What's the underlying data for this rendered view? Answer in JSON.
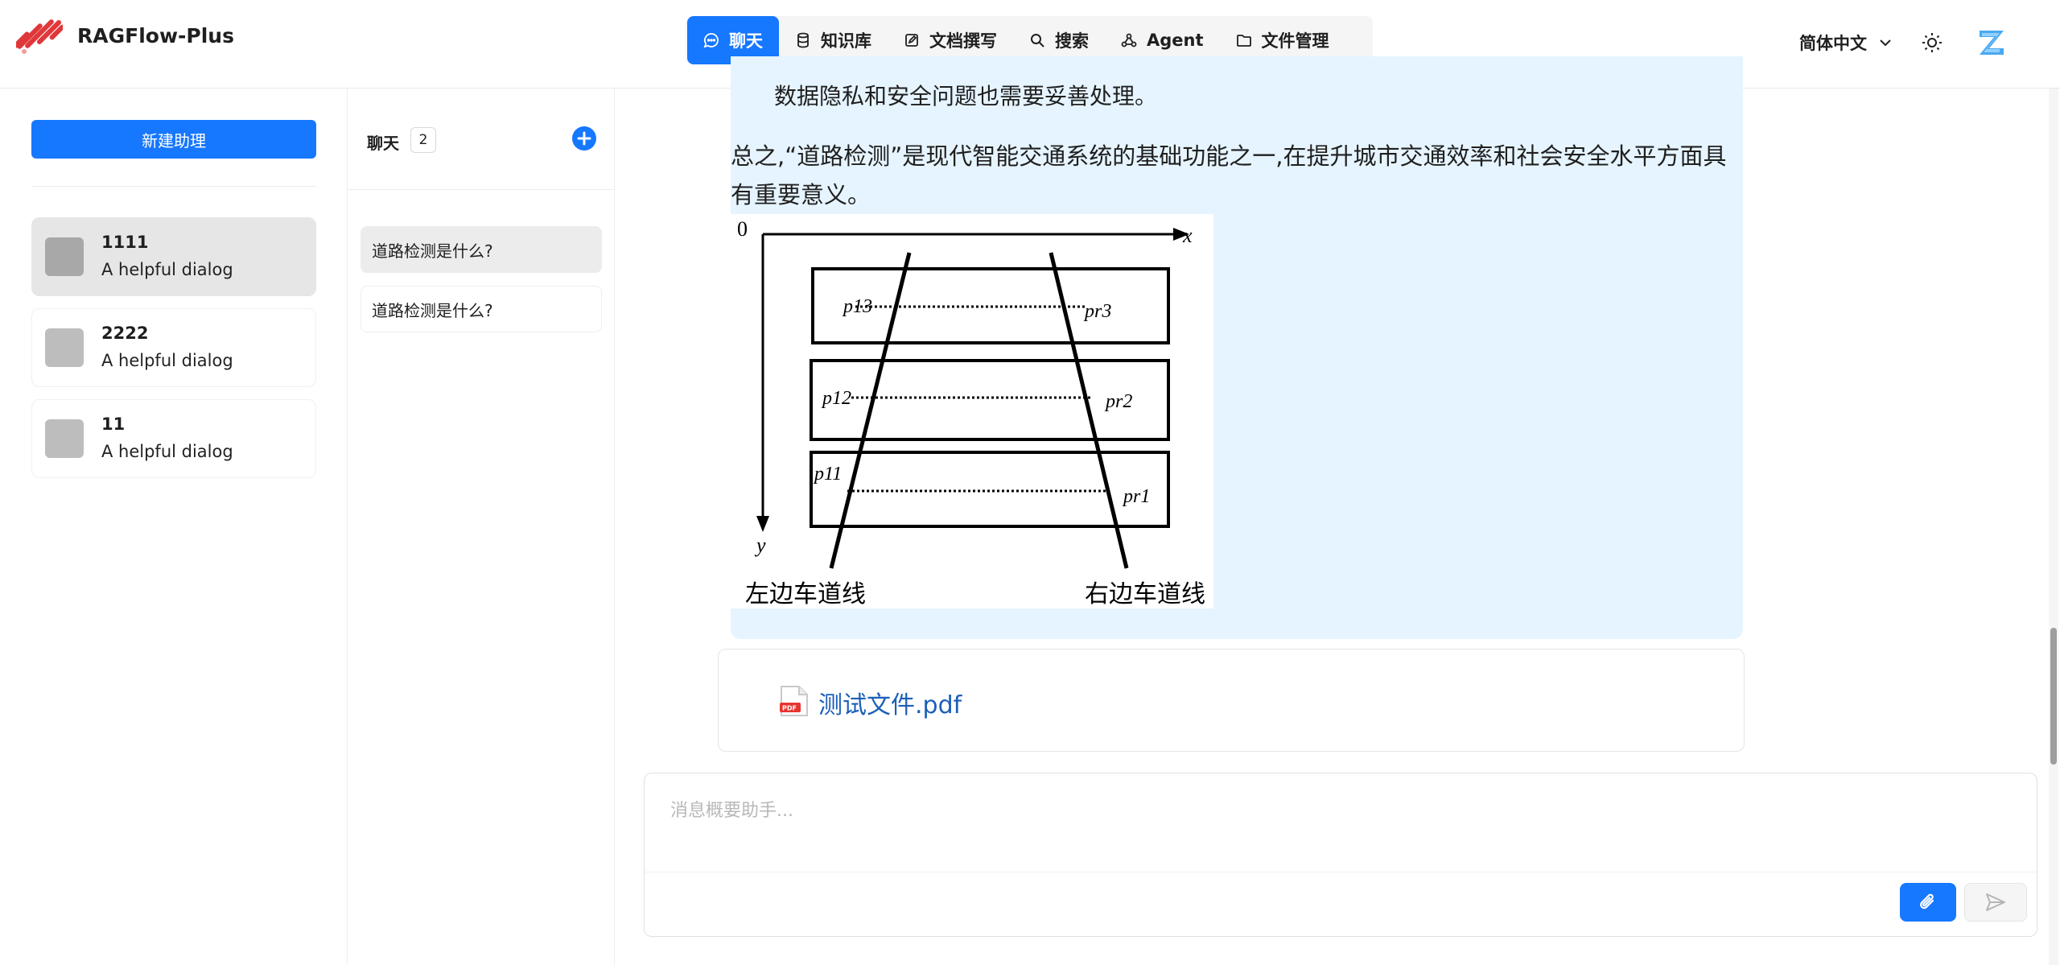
{
  "app": {
    "brand": "RAGFlow-Plus"
  },
  "nav": {
    "items": [
      {
        "label": "聊天",
        "icon": "chat-bubble-icon",
        "active": true
      },
      {
        "label": "知识库",
        "icon": "database-icon",
        "active": false
      },
      {
        "label": "文档撰写",
        "icon": "edit-icon",
        "active": false
      },
      {
        "label": "搜索",
        "icon": "search-icon",
        "active": false
      },
      {
        "label": "Agent",
        "icon": "agent-graph-icon",
        "active": false
      },
      {
        "label": "文件管理",
        "icon": "folder-icon",
        "active": false
      }
    ]
  },
  "header": {
    "language": "简体中文"
  },
  "assistants": {
    "new_label": "新建助理",
    "items": [
      {
        "name": "1111",
        "desc": "A helpful dialog",
        "selected": true
      },
      {
        "name": "2222",
        "desc": "A helpful dialog",
        "selected": false
      },
      {
        "name": "11",
        "desc": "A helpful dialog",
        "selected": false
      }
    ]
  },
  "conversations": {
    "title": "聊天",
    "count": "2",
    "items": [
      {
        "label": "道路检测是什么?",
        "selected": true
      },
      {
        "label": "道路检测是什么?",
        "selected": false
      }
    ]
  },
  "message": {
    "partial_text": "数据隐私和安全问题也需要妥善处理。",
    "summary_text": "总之,“道路检测”是现代智能交通系统的基础功能之一,在提升城市交通效率和社会安全水平方面具有重要意义。",
    "figure": {
      "origin": "0",
      "x_axis": "x",
      "y_axis": "y",
      "left_points": [
        "p13",
        "p12",
        "p11"
      ],
      "right_points": [
        "pr3",
        "pr2",
        "pr1"
      ],
      "left_caption": "左边车道线",
      "right_caption": "右边车道线"
    },
    "attachment": {
      "name": "测试文件.pdf",
      "type": "PDF"
    }
  },
  "composer": {
    "placeholder": "消息概要助手..."
  },
  "colors": {
    "primary": "#1677ff",
    "bubble": "#e6f4ff",
    "file_link": "#1b5fb8",
    "logo": "#e0383a"
  }
}
